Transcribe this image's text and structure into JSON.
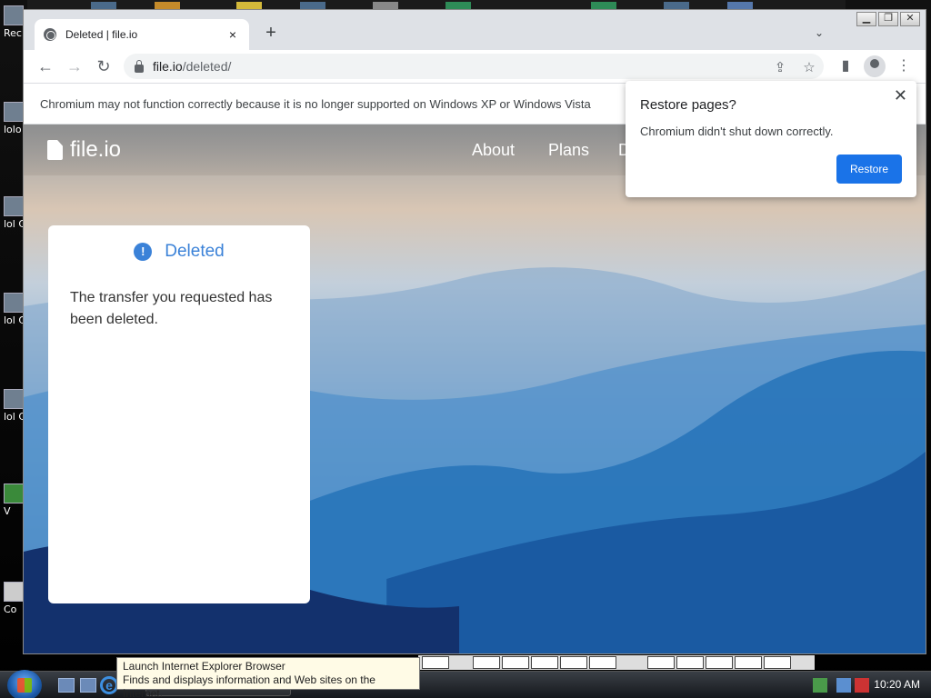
{
  "desktop": {
    "icons": [
      {
        "label": "Rec"
      },
      {
        "label": "lolo"
      },
      {
        "label": "lol C"
      },
      {
        "label": "lol Co"
      },
      {
        "label": "lol Co"
      },
      {
        "label": "V"
      },
      {
        "label": "Co"
      }
    ]
  },
  "browser": {
    "tab": {
      "title": "Deleted | file.io",
      "close": "×"
    },
    "new_tab": "+",
    "tab_menu": "⌄",
    "window_controls": {
      "minimize": "▁",
      "restore": "❐",
      "close": "✕"
    },
    "toolbar": {
      "back": "←",
      "forward": "→",
      "reload": "↻",
      "url_host": "file.io",
      "url_path": "/deleted/",
      "share": "⇪",
      "bookmark": "☆",
      "sidepanel": "▮",
      "menu": "⋮"
    },
    "infobar": "Chromium may not function correctly because it is no longer supported on Windows XP or Windows Vista"
  },
  "page": {
    "logo": "file.io",
    "nav": [
      "About",
      "Plans",
      "D"
    ],
    "card": {
      "icon": "!",
      "title": "Deleted",
      "text": "The transfer you requested has been deleted."
    }
  },
  "restore_popup": {
    "title": "Restore pages?",
    "text": "Chromium didn't shut down correctly.",
    "button": "Restore",
    "close": "✕"
  },
  "tooltip": {
    "title": "Launch Internet Explorer Browser",
    "text": "Finds and displays information and Web sites on the Internet."
  },
  "taskbar": {
    "ie_glyph": "e",
    "clock": "10:20 AM"
  },
  "colors": {
    "accent": "#1a73e8",
    "card_accent": "#3b82d8"
  }
}
